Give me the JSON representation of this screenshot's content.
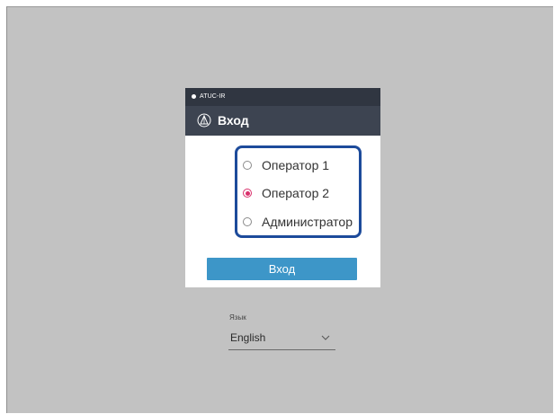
{
  "dialog": {
    "topbar_label": "ATUC-IR",
    "title": "Вход",
    "roles": [
      {
        "label": "Оператор 1",
        "selected": false
      },
      {
        "label": "Оператор 2",
        "selected": true
      },
      {
        "label": "Администратор",
        "selected": false
      }
    ],
    "login_label": "Вход"
  },
  "language": {
    "label": "Язык",
    "selected": "English"
  },
  "colors": {
    "screen_bg": "#c2c2c2",
    "topbar_bg": "#303641",
    "header_bg": "#3d4451",
    "group_border": "#1d4b9b",
    "radio_selected": "#d9306b",
    "button_bg": "#3d96c8"
  },
  "icons": {
    "logo": "triangle-logo-icon",
    "dropdown": "chevron-down-icon"
  }
}
